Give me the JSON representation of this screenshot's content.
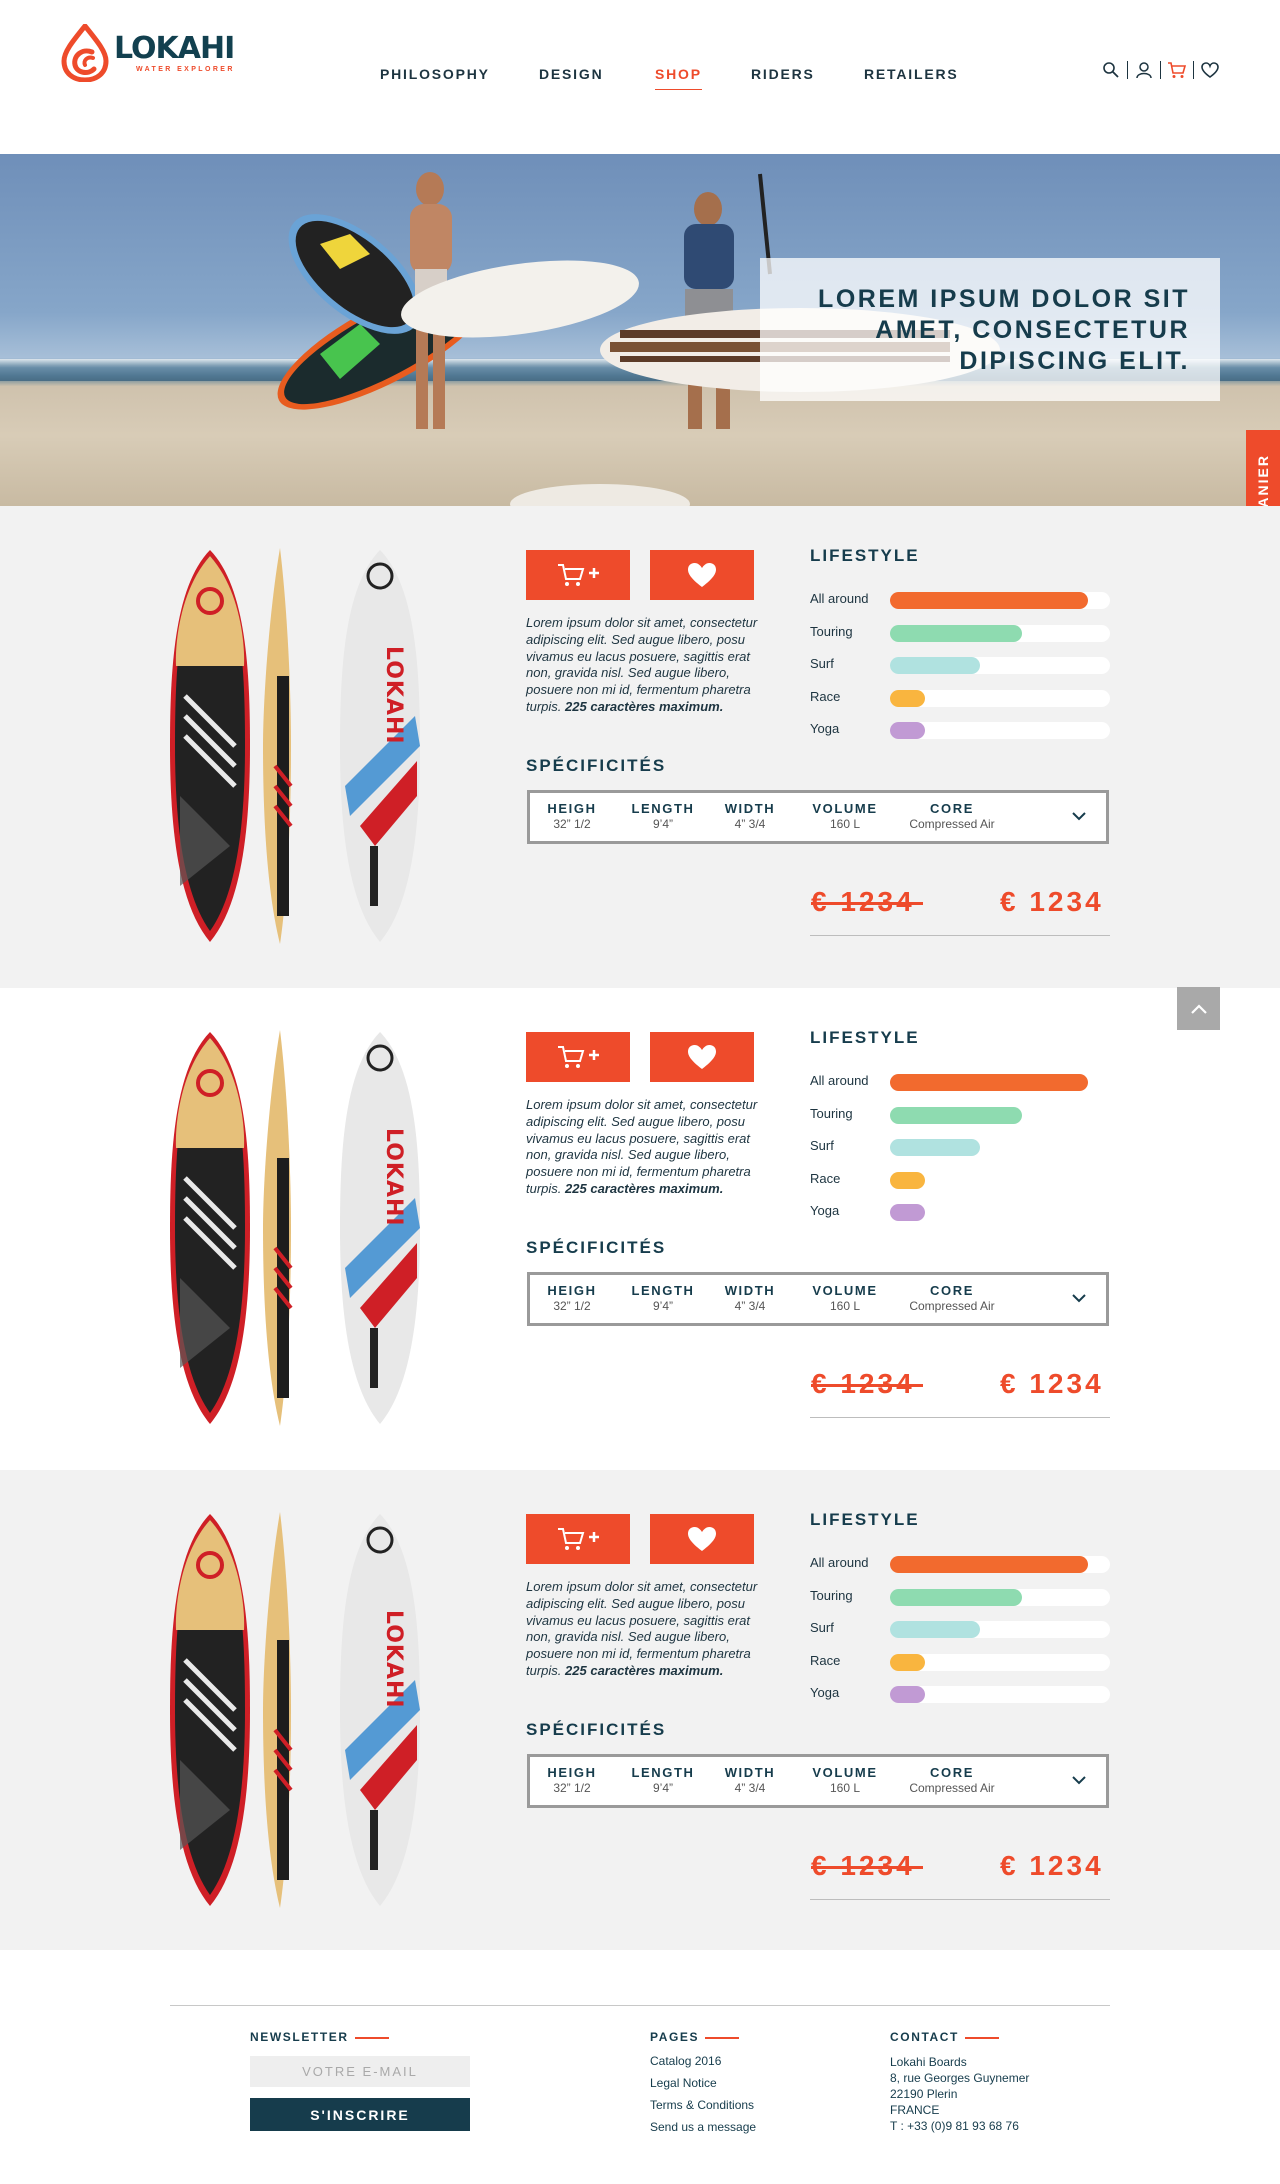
{
  "header": {
    "logo": {
      "name": "LOKAHI",
      "tagline": "WATER EXPLORER"
    },
    "nav": [
      {
        "label": "PHILOSOPHY",
        "active": false
      },
      {
        "label": "DESIGN",
        "active": false
      },
      {
        "label": "SHOP",
        "active": true
      },
      {
        "label": "RIDERS",
        "active": false
      },
      {
        "label": "RETAILERS",
        "active": false
      }
    ],
    "icons": [
      "search-icon",
      "user-icon",
      "cart-icon",
      "heart-icon"
    ]
  },
  "hero": {
    "title_line1": "LOREM IPSUM DOLOR SIT",
    "title_line2": "AMET, CONSECTETUR",
    "title_line3": "DIPISCING ELIT."
  },
  "cart_tab": {
    "label": "VOTRE PANIER"
  },
  "colors": {
    "accent": "#ee4b2b",
    "navy": "#163c4c",
    "all_around": "#f26a2e",
    "touring": "#8edbb0",
    "surf": "#b0e2e0",
    "race": "#f9b53f",
    "yoga": "#c19ad4"
  },
  "products": [
    {
      "description": "Lorem ipsum dolor sit amet, consectetur adipiscing elit. Sed augue libero, posu vivamus eu lacus posuere, sagittis erat non, gravida nisl. Sed augue libero, posuere non mi id, fermentum pharetra turpis.",
      "description_bold": "225 caractères maximum.",
      "board_brand": "LOKAHI",
      "lifestyle_title": "LIFESTYLE",
      "lifestyle": [
        {
          "label": "All around",
          "value": 0.9
        },
        {
          "label": "Touring",
          "value": 0.6
        },
        {
          "label": "Surf",
          "value": 0.41
        },
        {
          "label": "Race",
          "value": 0.16
        },
        {
          "label": "Yoga",
          "value": 0.16
        }
      ],
      "specs_title": "SPÉCIFICITÉS",
      "specs": [
        {
          "label": "HEIGH",
          "value": "32” 1/2"
        },
        {
          "label": "LENGTH",
          "value": "9’4”"
        },
        {
          "label": "WIDTH",
          "value": "4” 3/4"
        },
        {
          "label": "VOLUME",
          "value": "160 L"
        },
        {
          "label": "CORE",
          "value": "Compressed Air"
        }
      ],
      "old_price": "€ 1234",
      "new_price": "€ 1234"
    },
    {
      "description": "Lorem ipsum dolor sit amet, consectetur adipiscing elit. Sed augue libero, posu vivamus eu lacus posuere, sagittis erat non, gravida nisl. Sed augue libero, posuere non mi id, fermentum pharetra turpis.",
      "description_bold": "225 caractères maximum.",
      "board_brand": "LOKAHI",
      "lifestyle_title": "LIFESTYLE",
      "lifestyle": [
        {
          "label": "All around",
          "value": 0.9
        },
        {
          "label": "Touring",
          "value": 0.6
        },
        {
          "label": "Surf",
          "value": 0.41
        },
        {
          "label": "Race",
          "value": 0.16
        },
        {
          "label": "Yoga",
          "value": 0.16
        }
      ],
      "specs_title": "SPÉCIFICITÉS",
      "specs": [
        {
          "label": "HEIGH",
          "value": "32” 1/2"
        },
        {
          "label": "LENGTH",
          "value": "9’4”"
        },
        {
          "label": "WIDTH",
          "value": "4” 3/4"
        },
        {
          "label": "VOLUME",
          "value": "160 L"
        },
        {
          "label": "CORE",
          "value": "Compressed Air"
        }
      ],
      "old_price": "€ 1234",
      "new_price": "€ 1234"
    },
    {
      "description": "Lorem ipsum dolor sit amet, consectetur adipiscing elit. Sed augue libero, posu vivamus eu lacus posuere, sagittis erat non, gravida nisl. Sed augue libero, posuere non mi id, fermentum pharetra turpis.",
      "description_bold": "225 caractères maximum.",
      "board_brand": "LOKAHI",
      "lifestyle_title": "LIFESTYLE",
      "lifestyle": [
        {
          "label": "All around",
          "value": 0.9
        },
        {
          "label": "Touring",
          "value": 0.6
        },
        {
          "label": "Surf",
          "value": 0.41
        },
        {
          "label": "Race",
          "value": 0.16
        },
        {
          "label": "Yoga",
          "value": 0.16
        }
      ],
      "specs_title": "SPÉCIFICITÉS",
      "specs": [
        {
          "label": "HEIGH",
          "value": "32” 1/2"
        },
        {
          "label": "LENGTH",
          "value": "9’4”"
        },
        {
          "label": "WIDTH",
          "value": "4” 3/4"
        },
        {
          "label": "VOLUME",
          "value": "160 L"
        },
        {
          "label": "CORE",
          "value": "Compressed Air"
        }
      ],
      "old_price": "€ 1234",
      "new_price": "€ 1234"
    }
  ],
  "footer": {
    "newsletter": {
      "title": "NEWSLETTER",
      "placeholder": "VOTRE E-MAIL",
      "button": "S'INSCRIRE"
    },
    "pages": {
      "title": "PAGES",
      "links": [
        "Catalog 2016",
        "Legal Notice",
        "Terms & Conditions",
        "Send us a message"
      ]
    },
    "contact": {
      "title": "CONTACT",
      "lines": [
        "Lokahi Boards",
        "8, rue Georges Guynemer",
        "22190 Plerin",
        "FRANCE",
        "T : +33 (0)9 81 93 68 76"
      ]
    }
  }
}
